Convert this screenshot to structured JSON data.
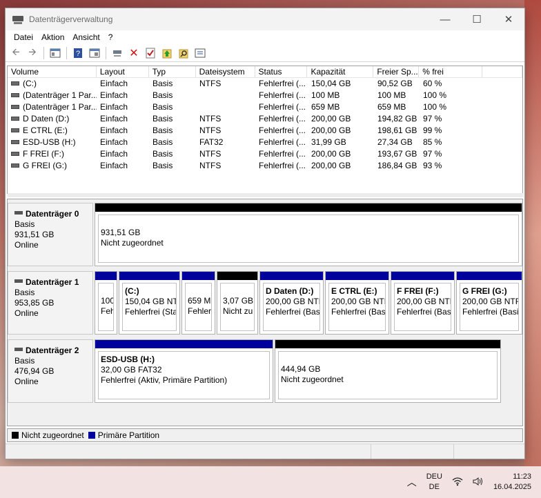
{
  "window": {
    "title": "Datenträgerverwaltung",
    "controls": {
      "minimize": "—",
      "maximize": "☐",
      "close": "✕"
    }
  },
  "menu": [
    "Datei",
    "Aktion",
    "Ansicht",
    "?"
  ],
  "toolbar": [
    "back-icon",
    "forward-icon",
    "console-tree-icon",
    "help-icon",
    "properties-icon",
    "connect-icon",
    "delete-icon",
    "check-icon",
    "upload-icon",
    "search-icon",
    "settings-icon"
  ],
  "volumes": {
    "headers": [
      "Volume",
      "Layout",
      "Typ",
      "Dateisystem",
      "Status",
      "Kapazität",
      "Freier Sp...",
      "% frei",
      ""
    ],
    "rows": [
      [
        "(C:)",
        "Einfach",
        "Basis",
        "NTFS",
        "Fehlerfrei (...",
        "150,04 GB",
        "90,52 GB",
        "60 %"
      ],
      [
        "(Datenträger 1 Par...",
        "Einfach",
        "Basis",
        "",
        "Fehlerfrei (...",
        "100 MB",
        "100 MB",
        "100 %"
      ],
      [
        "(Datenträger 1 Par...",
        "Einfach",
        "Basis",
        "",
        "Fehlerfrei (...",
        "659 MB",
        "659 MB",
        "100 %"
      ],
      [
        "D Daten (D:)",
        "Einfach",
        "Basis",
        "NTFS",
        "Fehlerfrei (...",
        "200,00 GB",
        "194,82 GB",
        "97 %"
      ],
      [
        "E CTRL (E:)",
        "Einfach",
        "Basis",
        "NTFS",
        "Fehlerfrei (...",
        "200,00 GB",
        "198,61 GB",
        "99 %"
      ],
      [
        "ESD-USB (H:)",
        "Einfach",
        "Basis",
        "FAT32",
        "Fehlerfrei (...",
        "31,99 GB",
        "27,34 GB",
        "85 %"
      ],
      [
        "F FREI (F:)",
        "Einfach",
        "Basis",
        "NTFS",
        "Fehlerfrei (...",
        "200,00 GB",
        "193,67 GB",
        "97 %"
      ],
      [
        "G FREI (G:)",
        "Einfach",
        "Basis",
        "NTFS",
        "Fehlerfrei (...",
        "200,00 GB",
        "186,84 GB",
        "93 %"
      ]
    ]
  },
  "disks": [
    {
      "name": "Datenträger 0",
      "type": "Basis",
      "size": "931,51 GB",
      "state": "Online",
      "partitions": [
        {
          "kind": "unallocated",
          "title": "",
          "line1": "931,51 GB",
          "line2": "Nicht zugeordnet"
        }
      ]
    },
    {
      "name": "Datenträger 1",
      "type": "Basis",
      "size": "953,85 GB",
      "state": "Online",
      "partitions": [
        {
          "kind": "primary",
          "title": "",
          "line1": "100",
          "line2": "Feh"
        },
        {
          "kind": "primary",
          "title": "(C:)",
          "line1": "150,04 GB NTF",
          "line2": "Fehlerfrei (Star"
        },
        {
          "kind": "primary",
          "title": "",
          "line1": "659 MI",
          "line2": "Fehlerl"
        },
        {
          "kind": "unallocated",
          "title": "",
          "line1": "3,07 GB",
          "line2": "Nicht zu"
        },
        {
          "kind": "primary",
          "title": "D Daten  (D:)",
          "line1": "200,00 GB NTFS",
          "line2": "Fehlerfrei (Basis"
        },
        {
          "kind": "primary",
          "title": "E CTRL  (E:)",
          "line1": "200,00 GB NTFS",
          "line2": "Fehlerfrei (Basis"
        },
        {
          "kind": "primary",
          "title": "F FREI  (F:)",
          "line1": "200,00 GB NTFS",
          "line2": "Fehlerfrei (Basis"
        },
        {
          "kind": "primary",
          "title": "G FREI  (G:)",
          "line1": "200,00 GB NTFS",
          "line2": "Fehlerfrei (Basis"
        }
      ]
    },
    {
      "name": "Datenträger 2",
      "type": "Basis",
      "size": "476,94 GB",
      "state": "Online",
      "partitions": [
        {
          "kind": "primary",
          "title": "ESD-USB  (H:)",
          "line1": "32,00 GB FAT32",
          "line2": "Fehlerfrei (Aktiv, Primäre Partition)"
        },
        {
          "kind": "unallocated",
          "title": "",
          "line1": "444,94 GB",
          "line2": "Nicht zugeordnet"
        }
      ]
    }
  ],
  "legend": [
    {
      "label": "Nicht zugeordnet",
      "color": "#000000"
    },
    {
      "label": "Primäre Partition",
      "color": "#00009c"
    }
  ],
  "taskbar": {
    "lang1": "DEU",
    "lang2": "DE",
    "time": "11:23",
    "date": "16.04.2025"
  }
}
